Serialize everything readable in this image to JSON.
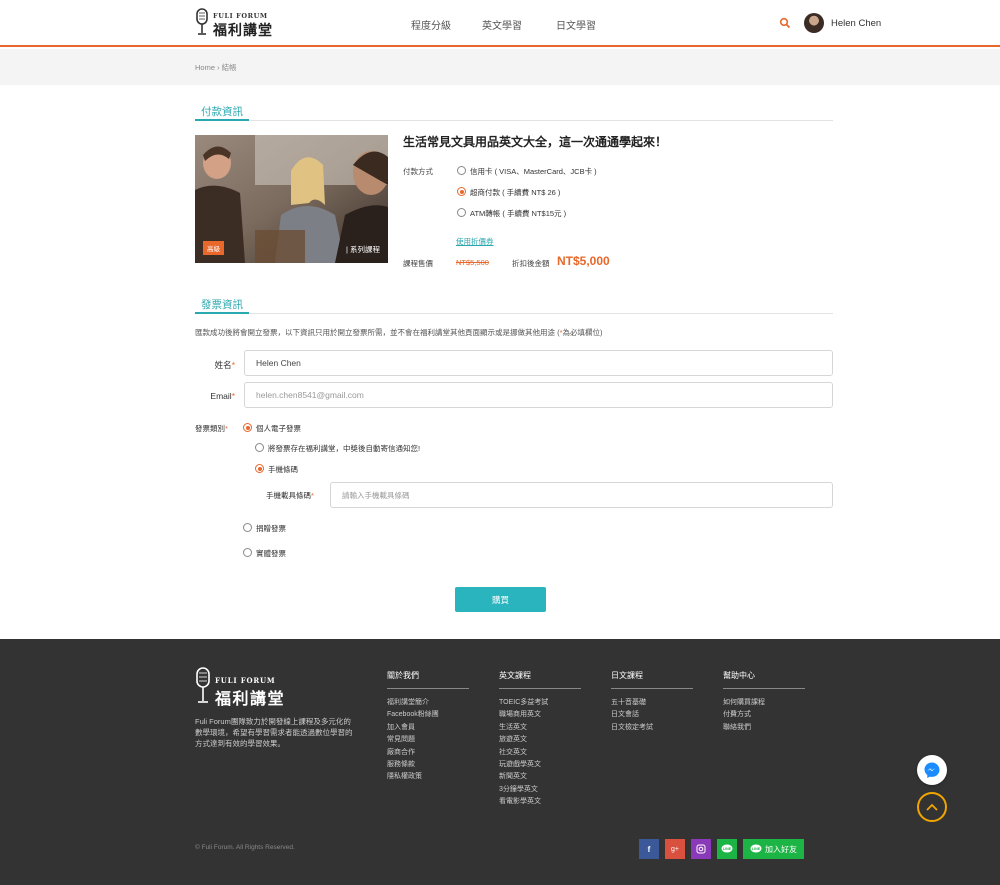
{
  "header": {
    "logo_en": "FULI FORUM",
    "logo_zh": "福利講堂",
    "nav": [
      "程度分級",
      "英文學習",
      "日文學習"
    ],
    "username": "Helen Chen"
  },
  "breadcrumb": "Home › 結帳",
  "payment": {
    "section_title": "付款資訊",
    "course_title": "生活常見文具用品英文大全，這一次通通學起來！",
    "level_badge": "高級",
    "series_label": "| 系列課程",
    "method_label": "付款方式",
    "options": [
      {
        "text": "信用卡 ( VISA、MasterCard、JCB卡 )",
        "selected": false
      },
      {
        "text": "超商付款 ( 手續費 NT$ 26 )",
        "selected": true
      },
      {
        "text": "ATM轉帳 ( 手續費 NT$15元 )",
        "selected": false
      }
    ],
    "coupon": "使用折價券",
    "price_label": "課程售價",
    "original_price": "NT$5,500",
    "final_label": "折扣後金額",
    "final_price": "NT$5,000"
  },
  "invoice": {
    "section_title": "發票資訊",
    "note": "匯款成功後將會開立發票，以下資訊只用於開立發票所需，並不會在福利講堂其他頁面顯示或是挪做其他用途 (",
    "note_star": "*",
    "note_end": "為必填欄位)",
    "name_label": "姓名",
    "name_value": "Helen Chen",
    "email_label": "Email",
    "email_value": "helen.chen8541@gmail.com",
    "type_label": "發票類別",
    "type_electronic": "個人電子發票",
    "store_option": "將發票存在福利講堂，中獎後自動寄信通知您!",
    "mobile_option": "手機條碼",
    "carrier_label": "手機載具條碼",
    "carrier_placeholder": "請輸入手機載具條碼",
    "donate_option": "捐贈發票",
    "paper_option": "實體發票",
    "required_mark": "*"
  },
  "buy_button": "購買",
  "footer": {
    "logo_en": "FULI FORUM",
    "logo_zh": "福利講堂",
    "description": "Fuli Forum團隊致力於開發線上課程及多元化的數學環境，希望有學習需求者能透過數位學習的方式達到有效的學習效果。",
    "columns": [
      {
        "title": "關於我們",
        "items": [
          "福利講堂簡介",
          "Facebook粉絲團",
          "加入會員",
          "常見問題",
          "廠商合作",
          "服務條款",
          "隱私權政策"
        ]
      },
      {
        "title": "英文課程",
        "items": [
          "TOEIC多益考試",
          "職場商用英文",
          "生活英文",
          "旅遊英文",
          "社交英文",
          "玩遊戲學英文",
          "新聞英文",
          "3分鐘學英文",
          "看電影學英文"
        ]
      },
      {
        "title": "日文課程",
        "items": [
          "五十音基礎",
          "日文會話",
          "日文檢定考試"
        ]
      },
      {
        "title": "幫助中心",
        "items": [
          "如何購買課程",
          "付費方式",
          "聯絡我們"
        ]
      }
    ],
    "copyright": "© Fuli Forum. All Rights Reserved.",
    "social": [
      "f",
      "g+"
    ],
    "line_add": "加入好友"
  },
  "colors": {
    "accent": "#e8672a",
    "teal": "#2aa8b0",
    "footer_bg": "#333333"
  }
}
